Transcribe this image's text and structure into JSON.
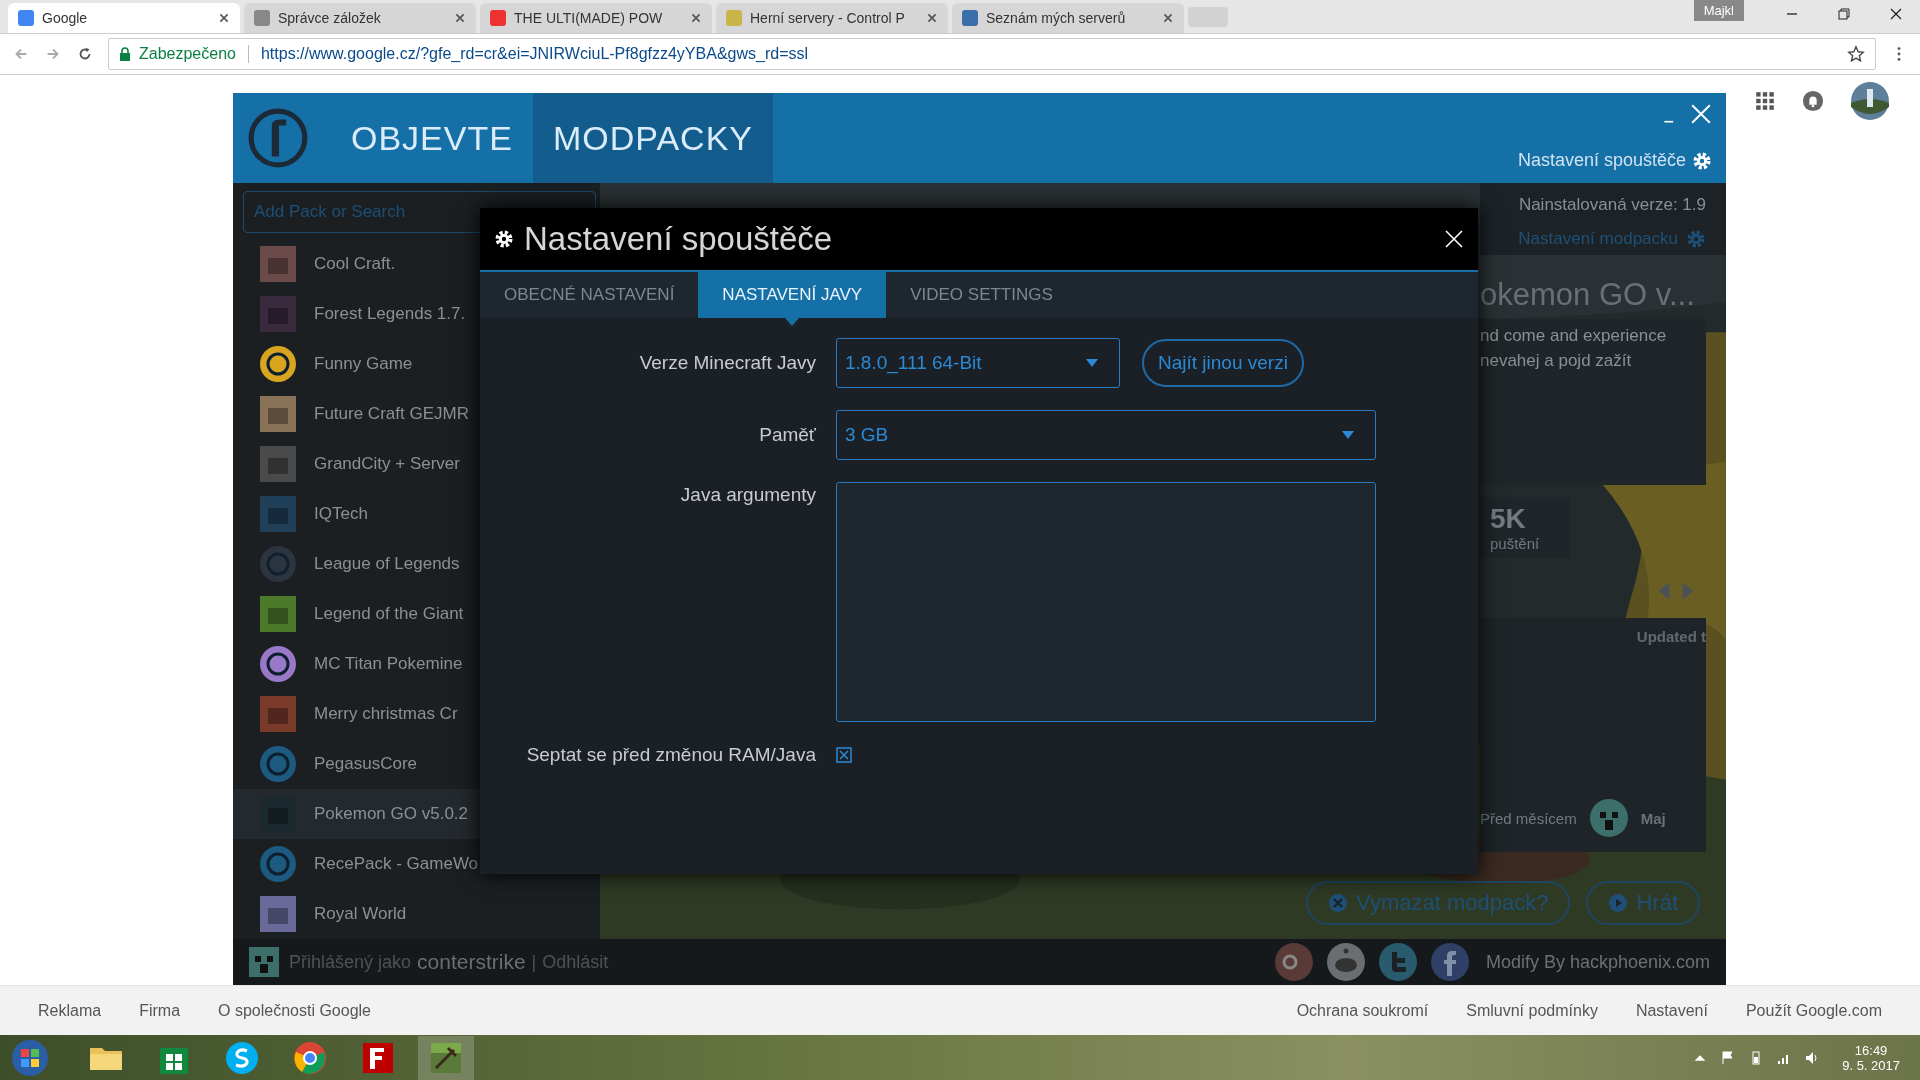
{
  "browser": {
    "tabs": [
      {
        "title": "Google",
        "selected": true
      },
      {
        "title": "Správce záložek",
        "selected": false
      },
      {
        "title": "THE ULTI(MADE) POW",
        "selected": false
      },
      {
        "title": "Herní servery - Control P",
        "selected": false
      },
      {
        "title": "Seznám mých serverů",
        "selected": false
      }
    ],
    "profile_name": "Majkl",
    "security_label": "Zabezpečeno",
    "url": "https://www.google.cz/?gfe_rd=cr&ei=JNIRWciuL-Pf8gfzz4yYBA&gws_rd=ssl"
  },
  "launcher": {
    "nav": [
      {
        "label": "OBJEVTE",
        "selected": false
      },
      {
        "label": "MODPACKY",
        "selected": true
      }
    ],
    "settings_link": "Nastavení spouštěče",
    "search": {
      "placeholder": "Add Pack or Search"
    },
    "packs": [
      {
        "name": "Cool Craft.",
        "selected": false
      },
      {
        "name": "Forest Legends 1.7.",
        "selected": false
      },
      {
        "name": "Funny Game",
        "selected": false
      },
      {
        "name": "Future Craft GEJMR",
        "selected": false
      },
      {
        "name": "GrandCity + Server",
        "selected": false
      },
      {
        "name": "IQTech",
        "selected": false
      },
      {
        "name": "League of Legends",
        "selected": false
      },
      {
        "name": "Legend of the Giant",
        "selected": false
      },
      {
        "name": "MC Titan Pokemine",
        "selected": false
      },
      {
        "name": "Merry christmas Cr",
        "selected": false
      },
      {
        "name": "PegasusCore",
        "selected": false
      },
      {
        "name": "Pokemon GO v5.0.2",
        "selected": true
      },
      {
        "name": "RecePack - GameWo",
        "selected": false
      },
      {
        "name": "Royal World",
        "selected": false
      }
    ],
    "pack_detail": {
      "installed_version": "Nainstalovaná verze: 1.9",
      "settings_link": "Nastavení modpacku",
      "title": "okemon GO v...",
      "description": [
        "nd come and experience",
        "nevahej a pojd zažít"
      ],
      "stat_value": "5K",
      "stat_label": "puštění",
      "updated": "Updated t",
      "date": "Před měsícem",
      "author": "Maj",
      "buttons": [
        {
          "kind": "delete",
          "label": "Vymazat modpack?"
        },
        {
          "kind": "play",
          "label": "Hrát"
        }
      ]
    },
    "footer": {
      "user_label": "Přihlášený jako",
      "username": "conterstrike",
      "separator": "|",
      "logout": "Odhlásit",
      "credit": "Modify By hackphoenix.com"
    },
    "dialog": {
      "title": "Nastavení spouštěče",
      "tabs": [
        {
          "label": "OBECNÉ NASTAVENÍ",
          "selected": false
        },
        {
          "label": "NASTAVENÍ JAVY",
          "selected": true
        },
        {
          "label": "VIDEO SETTINGS",
          "selected": false
        }
      ],
      "java_version": {
        "label": "Verze Minecraft Javy",
        "value": "1.8.0_111 64-Bit"
      },
      "find_button": "Najít jinou verzi",
      "memory": {
        "label": "Paměť",
        "value": "3 GB"
      },
      "java_args": {
        "label": "Java argumenty"
      },
      "ask_before_change": {
        "label": "Septat se před změnou RAM/Java",
        "checked": true
      }
    }
  },
  "google_footer": {
    "left": [
      "Reklama",
      "Firma",
      "O společnosti Google"
    ],
    "right": [
      "Ochrana soukromí",
      "Smluvní podmínky",
      "Nastavení",
      "Použít Google.com"
    ]
  },
  "taskbar": {
    "time": "16:49",
    "date": "9. 5. 2017"
  }
}
